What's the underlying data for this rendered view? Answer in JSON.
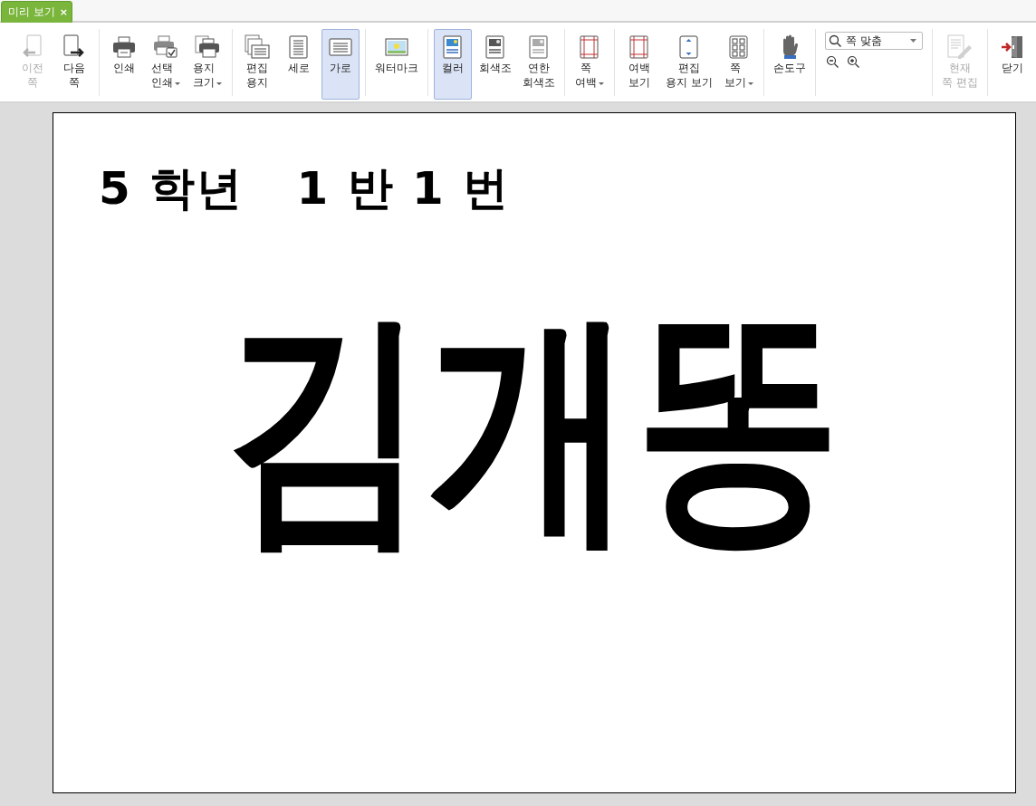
{
  "tab": {
    "label": "미리 보기",
    "close": "×"
  },
  "toolbar": [
    {
      "kind": "buttons",
      "buttons": [
        {
          "label": "이전\n쪽",
          "disabled": true,
          "selected": false,
          "dropdown": false
        },
        {
          "label": "다음\n쪽",
          "disabled": false,
          "selected": false,
          "dropdown": false
        }
      ]
    },
    {
      "kind": "buttons",
      "buttons": [
        {
          "label": "인쇄",
          "disabled": false,
          "selected": false,
          "dropdown": false
        },
        {
          "label": "선택\n인쇄",
          "disabled": false,
          "selected": false,
          "dropdown": true
        },
        {
          "label": "용지\n크기",
          "disabled": false,
          "selected": false,
          "dropdown": true
        }
      ]
    },
    {
      "kind": "buttons",
      "buttons": [
        {
          "label": "편집\n용지",
          "disabled": false,
          "selected": false,
          "dropdown": false
        },
        {
          "label": "세로",
          "disabled": false,
          "selected": false,
          "dropdown": false
        },
        {
          "label": "가로",
          "disabled": false,
          "selected": true,
          "dropdown": false
        }
      ]
    },
    {
      "kind": "buttons",
      "buttons": [
        {
          "label": "워터마크",
          "disabled": false,
          "selected": false,
          "dropdown": false
        }
      ]
    },
    {
      "kind": "buttons",
      "buttons": [
        {
          "label": "컬러",
          "disabled": false,
          "selected": true,
          "dropdown": false
        },
        {
          "label": "회색조",
          "disabled": false,
          "selected": false,
          "dropdown": false
        },
        {
          "label": "연한\n회색조",
          "disabled": false,
          "selected": false,
          "dropdown": false
        }
      ]
    },
    {
      "kind": "buttons",
      "buttons": [
        {
          "label": "쪽\n여백",
          "disabled": false,
          "selected": false,
          "dropdown": true
        }
      ]
    },
    {
      "kind": "buttons",
      "buttons": [
        {
          "label": "여백\n보기",
          "disabled": false,
          "selected": false,
          "dropdown": false
        },
        {
          "label": "편집\n용지 보기",
          "disabled": false,
          "selected": false,
          "dropdown": false
        },
        {
          "label": "쪽\n보기",
          "disabled": false,
          "selected": false,
          "dropdown": true
        }
      ]
    },
    {
      "kind": "buttons",
      "buttons": [
        {
          "label": "손도구",
          "disabled": false,
          "selected": false,
          "dropdown": false
        }
      ]
    },
    {
      "kind": "zoom",
      "value": "쪽 맞춤"
    },
    {
      "kind": "buttons",
      "buttons": [
        {
          "label": "현재\n쪽 편집",
          "disabled": true,
          "selected": false,
          "dropdown": false
        }
      ]
    },
    {
      "kind": "buttons",
      "buttons": [
        {
          "label": "닫기",
          "disabled": false,
          "selected": false,
          "dropdown": false
        }
      ]
    }
  ],
  "document": {
    "heading": "5 학년   1 반 1 번",
    "name": "김개똥"
  }
}
